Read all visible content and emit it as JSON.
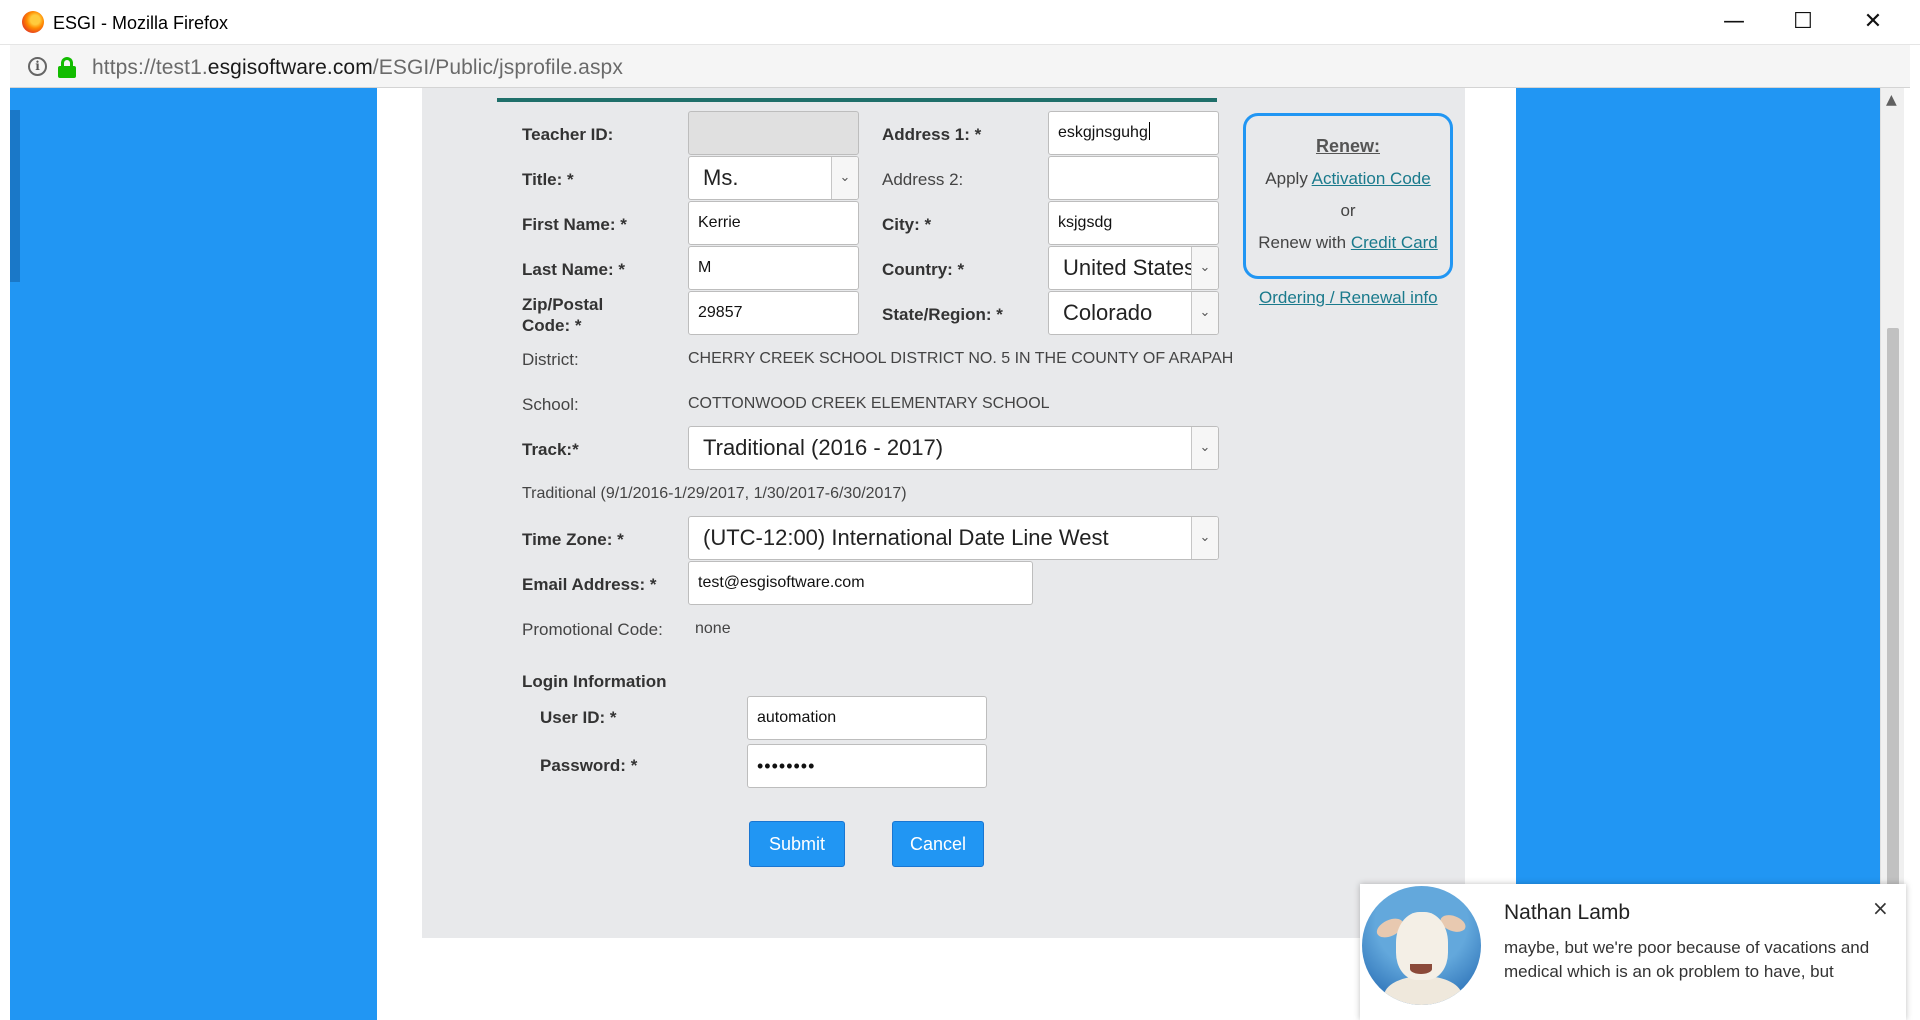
{
  "window": {
    "title": "ESGI - Mozilla Firefox",
    "minimize": "—",
    "maximize": "☐",
    "close": "✕"
  },
  "address": {
    "prefix": "https://test1.",
    "domain": "esgisoftware.com",
    "path": "/ESGI/Public/jsprofile.aspx",
    "info_glyph": "i"
  },
  "form": {
    "teacher_id": {
      "label": "Teacher ID:",
      "value": ""
    },
    "title": {
      "label": "Title: *",
      "value": "Ms."
    },
    "first_name": {
      "label": "First Name: *",
      "value": "Kerrie"
    },
    "last_name": {
      "label": "Last Name: *",
      "value": "M"
    },
    "zip": {
      "label_line1": "Zip/Postal",
      "label_line2": "Code: *",
      "value": "29857"
    },
    "address1": {
      "label": "Address 1: *",
      "value": "eskgjnsguhg"
    },
    "address2": {
      "label": "Address 2:",
      "value": ""
    },
    "city": {
      "label": "City: *",
      "value": "ksjgsdg"
    },
    "country": {
      "label": "Country: *",
      "value": "United States"
    },
    "state": {
      "label": "State/Region: *",
      "value": "Colorado"
    },
    "district": {
      "label": "District:",
      "value": "CHERRY CREEK SCHOOL DISTRICT NO. 5 IN THE COUNTY OF ARAPAH"
    },
    "school": {
      "label": "School:",
      "value": "COTTONWOOD CREEK ELEMENTARY SCHOOL"
    },
    "track": {
      "label": "Track:*",
      "value": "Traditional (2016 - 2017)",
      "description": "Traditional (9/1/2016-1/29/2017, 1/30/2017-6/30/2017)"
    },
    "timezone": {
      "label": "Time Zone: *",
      "value": "(UTC-12:00) International Date Line West"
    },
    "email": {
      "label": "Email Address: *",
      "value": "test@esgisoftware.com"
    },
    "promo": {
      "label": "Promotional Code:",
      "value": "none"
    },
    "login_heading": "Login Information",
    "user_id": {
      "label": "User ID: *",
      "value": "automation"
    },
    "password": {
      "label": "Password: *",
      "value": "••••••••"
    },
    "submit_label": "Submit",
    "cancel_label": "Cancel",
    "select_arrow": "⌄"
  },
  "renew": {
    "title": "Renew:",
    "apply_text": "Apply",
    "activation_link": "Activation Code",
    "or_text": "or",
    "renew_text": "Renew with",
    "credit_link": "Credit Card",
    "ordering_link": "Ordering / Renewal info"
  },
  "notification": {
    "name": "Nathan Lamb",
    "message": "maybe, but we're poor because of vacations and medical which is an ok problem to have, but",
    "close": "×"
  },
  "colors": {
    "accent_blue": "#2196f3",
    "teal": "#1f6f6a",
    "link": "#1a7a8c",
    "panel": "#e8e9eb"
  }
}
